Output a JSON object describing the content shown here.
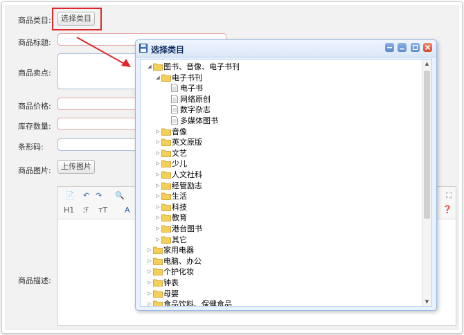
{
  "form": {
    "category_label": "商品类目:",
    "category_button": "选择类目",
    "title_label": "商品标题:",
    "selling_point_label": "商品卖点:",
    "price_label": "商品价格:",
    "stock_label": "库存数量:",
    "barcode_label": "条形码:",
    "image_label": "商品图片:",
    "upload_button": "上传图片",
    "description_label": "商品描述:"
  },
  "editor": {
    "toolbar_row1": [
      "📄",
      "↶",
      "↷",
      "🔍"
    ],
    "heading_button": "H1",
    "font_button": "ℱ",
    "size_button": "тT",
    "color_button": "A"
  },
  "dialog": {
    "title": "选择类目",
    "tree": [
      {
        "label": "图书、音像、电子书刊",
        "level": 0,
        "expanded": true,
        "folder": true
      },
      {
        "label": "电子书刊",
        "level": 1,
        "expanded": true,
        "folder": true
      },
      {
        "label": "电子书",
        "level": 2,
        "folder": false
      },
      {
        "label": "网络原创",
        "level": 2,
        "folder": false
      },
      {
        "label": "数字杂志",
        "level": 2,
        "folder": false
      },
      {
        "label": "多媒体图书",
        "level": 2,
        "folder": false
      },
      {
        "label": "音像",
        "level": 1,
        "expanded": false,
        "folder": true
      },
      {
        "label": "英文原版",
        "level": 1,
        "expanded": false,
        "folder": true
      },
      {
        "label": "文艺",
        "level": 1,
        "expanded": false,
        "folder": true
      },
      {
        "label": "少儿",
        "level": 1,
        "expanded": false,
        "folder": true
      },
      {
        "label": "人文社科",
        "level": 1,
        "expanded": false,
        "folder": true
      },
      {
        "label": "经管励志",
        "level": 1,
        "expanded": false,
        "folder": true
      },
      {
        "label": "生活",
        "level": 1,
        "expanded": false,
        "folder": true
      },
      {
        "label": "科技",
        "level": 1,
        "expanded": false,
        "folder": true
      },
      {
        "label": "教育",
        "level": 1,
        "expanded": false,
        "folder": true
      },
      {
        "label": "港台图书",
        "level": 1,
        "expanded": false,
        "folder": true
      },
      {
        "label": "其它",
        "level": 1,
        "expanded": false,
        "folder": true
      },
      {
        "label": "家用电器",
        "level": 0,
        "expanded": false,
        "folder": true
      },
      {
        "label": "电脑、办公",
        "level": 0,
        "expanded": false,
        "folder": true
      },
      {
        "label": "个护化妆",
        "level": 0,
        "expanded": false,
        "folder": true
      },
      {
        "label": "钟表",
        "level": 0,
        "expanded": false,
        "folder": true
      },
      {
        "label": "母婴",
        "level": 0,
        "expanded": false,
        "folder": true
      },
      {
        "label": "食品饮料、保健食品",
        "level": 0,
        "expanded": false,
        "folder": true
      }
    ]
  },
  "colors": {
    "highlight": "#e0282a",
    "arrow": "#e0282a",
    "dialog_border": "#95b8e7",
    "folder": "#f5cf5a"
  }
}
